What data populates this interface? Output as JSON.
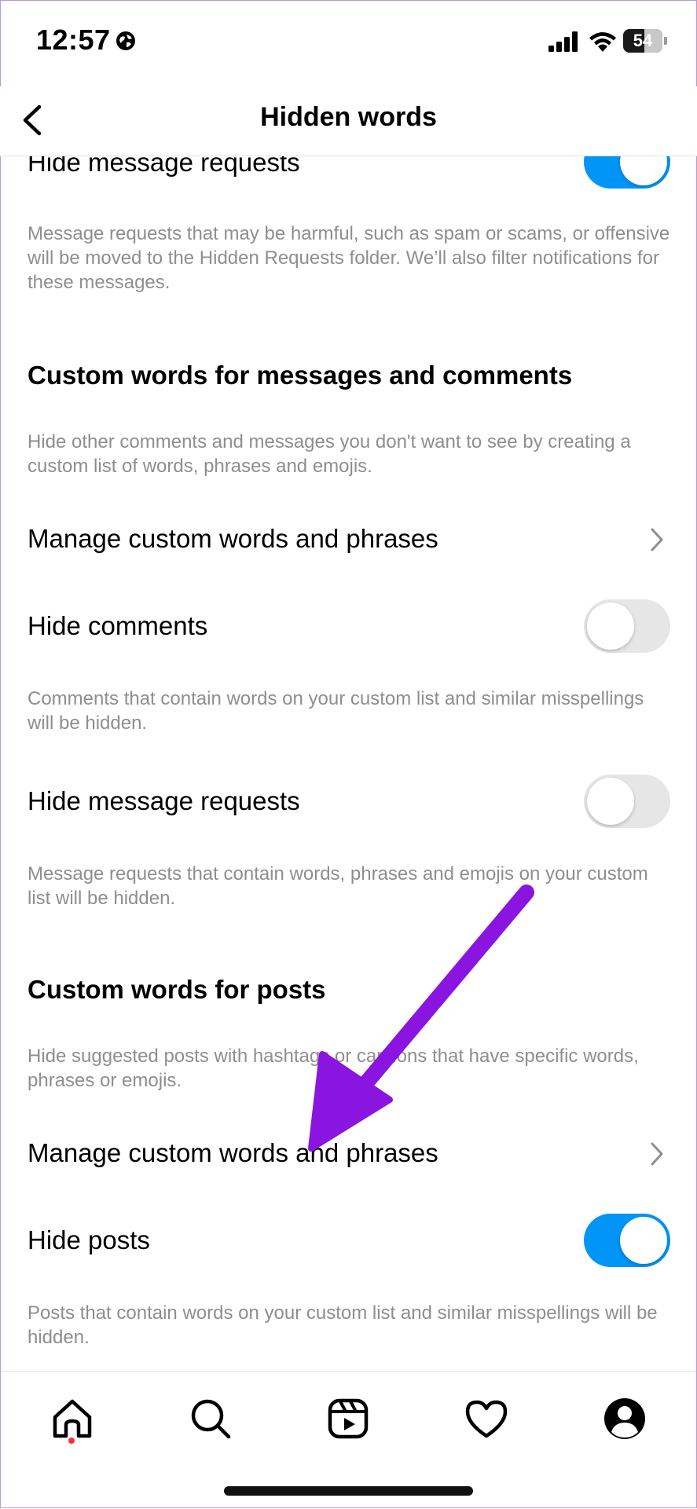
{
  "status_bar": {
    "time": "12:57",
    "battery": "54",
    "battery_level": 0.54
  },
  "header": {
    "title": "Hidden words"
  },
  "top_section": {
    "row_label": "Hide message requests",
    "toggle_on": true,
    "description": "Message requests that may be harmful, such as spam or scams, or offensive will be moved to the Hidden Requests folder. We’ll also filter notifications for these messages."
  },
  "custom_messages_comments": {
    "title": "Custom words for messages and comments",
    "description": "Hide other comments and messages you don't want to see by creating a custom list of words, phrases and emojis.",
    "manage_label": "Manage custom words and phrases",
    "hide_comments_label": "Hide comments",
    "hide_comments_on": false,
    "hide_comments_description": "Comments that contain words on your custom list and similar misspellings will be hidden.",
    "hide_requests_label": "Hide message requests",
    "hide_requests_on": false,
    "hide_requests_description": "Message requests that contain words, phrases and emojis on your custom list will be hidden."
  },
  "custom_posts": {
    "title": "Custom words for posts",
    "description": "Hide suggested posts with hashtags or captions that have specific words, phrases or emojis.",
    "manage_label": "Manage custom words and phrases",
    "hide_posts_label": "Hide posts",
    "hide_posts_on": true,
    "hide_posts_description": "Posts that contain words on your custom list and similar misspellings will be hidden."
  },
  "annotation": {
    "arrow_color": "#8a14e0"
  },
  "colors": {
    "toggle_on": "#0095f6",
    "toggle_off": "#e6e6e6",
    "secondary_text": "#8e8e8e",
    "notification_dot": "#ff3040"
  },
  "tab_bar": {
    "icons": [
      "home-icon",
      "search-icon",
      "reels-icon",
      "heart-icon",
      "profile-icon"
    ]
  }
}
